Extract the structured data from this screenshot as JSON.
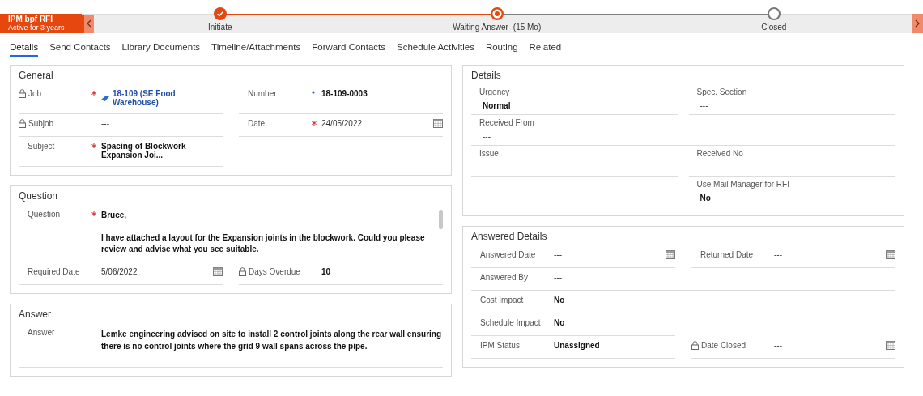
{
  "process": {
    "name": "IPM bpf RFI",
    "subtitle": "Active for 3 years",
    "stages": [
      {
        "label": "Initiate",
        "kind": "completed"
      },
      {
        "label": "Waiting Answer",
        "duration": "(15 Mo)",
        "kind": "active"
      },
      {
        "label": "Closed",
        "kind": "pending"
      }
    ]
  },
  "tabs": [
    {
      "label": "Details",
      "selected": true
    },
    {
      "label": "Send Contacts",
      "selected": false
    },
    {
      "label": "Library Documents",
      "selected": false
    },
    {
      "label": "Timeline/Attachments",
      "selected": false
    },
    {
      "label": "Forward Contacts",
      "selected": false
    },
    {
      "label": "Schedule Activities",
      "selected": false
    },
    {
      "label": "Routing",
      "selected": false
    },
    {
      "label": "Related",
      "selected": false
    }
  ],
  "left_column": [
    {
      "title": "General",
      "kind": "side",
      "rows": [
        [
          {
            "label": "Job",
            "locked": true,
            "required": true,
            "recommended": false,
            "value": "18-109 (SE Food Warehouse)",
            "kind": "link",
            "calendar": false,
            "wide": false
          },
          {
            "label": "Number",
            "locked": false,
            "required": false,
            "recommended": true,
            "value": "18-109-0003",
            "kind": "bold",
            "calendar": false,
            "wide": false
          }
        ],
        [
          {
            "label": "Subjob",
            "locked": true,
            "required": false,
            "recommended": false,
            "value": "---",
            "kind": "plain",
            "calendar": false,
            "wide": false
          },
          {
            "label": "Date",
            "locked": false,
            "required": true,
            "recommended": false,
            "value": "24/05/2022",
            "kind": "plain",
            "calendar": true,
            "wide": false
          }
        ],
        [
          {
            "label": "Subject",
            "locked": false,
            "required": true,
            "recommended": false,
            "value": "Spacing of Blockwork Expansion Joi...",
            "kind": "bold",
            "calendar": false,
            "wide": false
          },
          null
        ]
      ]
    },
    {
      "title": "Question",
      "kind": "side",
      "rows": [
        [
          {
            "label": "Question",
            "locked": false,
            "required": true,
            "recommended": false,
            "value": "Bruce,\n\nI have attached a layout for the Expansion joints in the blockwork. Could you please review and advise what you see suitable.",
            "kind": "multiline",
            "calendar": false,
            "wide": true
          }
        ],
        [
          {
            "label": "Required Date",
            "locked": false,
            "required": false,
            "recommended": false,
            "value": "5/06/2022",
            "kind": "plain",
            "calendar": true,
            "wide": false
          },
          {
            "label": "Days Overdue",
            "locked": true,
            "required": false,
            "recommended": false,
            "value": "10",
            "kind": "bold",
            "calendar": false,
            "wide": false
          }
        ]
      ]
    },
    {
      "title": "Answer",
      "kind": "side",
      "rows": [
        [
          {
            "label": "Answer",
            "locked": false,
            "required": false,
            "recommended": false,
            "value": "Lemke engineering advised on site to install 2 control joints along the rear wall ensuring there is no control joints where the grid 9 wall spans across the pipe.",
            "kind": "paragraph",
            "calendar": false,
            "wide": true
          }
        ]
      ]
    }
  ],
  "right_column": [
    {
      "title": "Details",
      "kind": "stacked",
      "rows": [
        [
          {
            "label": "Urgency",
            "locked": false,
            "required": false,
            "recommended": false,
            "value": "Normal",
            "kind": "bold",
            "calendar": false,
            "wide": false
          },
          {
            "label": "Spec. Section",
            "locked": false,
            "required": false,
            "recommended": false,
            "value": "---",
            "kind": "plain",
            "calendar": false,
            "wide": false
          }
        ],
        [
          {
            "label": "Received From",
            "locked": false,
            "required": false,
            "recommended": false,
            "value": "---",
            "kind": "plain",
            "calendar": false,
            "wide": true
          }
        ],
        [
          {
            "label": "Issue",
            "locked": false,
            "required": false,
            "recommended": false,
            "value": "---",
            "kind": "plain",
            "calendar": false,
            "wide": false
          },
          {
            "label": "Received No",
            "locked": false,
            "required": false,
            "recommended": false,
            "value": "---",
            "kind": "plain",
            "calendar": false,
            "wide": false
          }
        ],
        [
          null,
          {
            "label": "Use Mail Manager for RFI",
            "locked": false,
            "required": false,
            "recommended": false,
            "value": "No",
            "kind": "bold",
            "calendar": false,
            "wide": false
          }
        ]
      ]
    },
    {
      "title": "Answered Details",
      "kind": "side",
      "rows": [
        [
          {
            "label": "Answered Date",
            "locked": false,
            "required": false,
            "recommended": false,
            "value": "---",
            "kind": "plain",
            "calendar": true,
            "wide": false
          },
          {
            "label": "Returned Date",
            "locked": false,
            "required": false,
            "recommended": false,
            "value": "---",
            "kind": "plain",
            "calendar": true,
            "wide": false
          }
        ],
        [
          {
            "label": "Answered By",
            "locked": false,
            "required": false,
            "recommended": false,
            "value": "---",
            "kind": "plain",
            "calendar": false,
            "wide": true
          }
        ],
        [
          {
            "label": "Cost Impact",
            "locked": false,
            "required": false,
            "recommended": false,
            "value": "No",
            "kind": "bold",
            "calendar": false,
            "wide": false
          },
          null
        ],
        [
          {
            "label": "Schedule Impact",
            "locked": false,
            "required": false,
            "recommended": false,
            "value": "No",
            "kind": "bold",
            "calendar": false,
            "wide": false
          },
          null
        ],
        [
          {
            "label": "IPM Status",
            "locked": false,
            "required": false,
            "recommended": false,
            "value": "Unassigned",
            "kind": "bold",
            "calendar": false,
            "wide": false
          },
          {
            "label": "Date Closed",
            "locked": true,
            "required": false,
            "recommended": false,
            "value": "---",
            "kind": "plain",
            "calendar": true,
            "wide": false
          }
        ]
      ]
    }
  ]
}
